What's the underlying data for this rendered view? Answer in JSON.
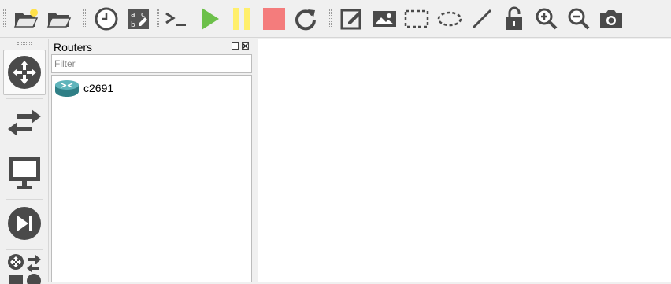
{
  "toolbar": {
    "buttons": [
      {
        "name": "new-project",
        "icon": "folder-new-icon"
      },
      {
        "name": "open-project",
        "icon": "folder-open-icon"
      },
      {
        "name": "snapshot",
        "icon": "clock-icon"
      },
      {
        "name": "show-interface-labels",
        "icon": "abc-labels-icon"
      },
      {
        "name": "console-all",
        "icon": "terminal-icon"
      },
      {
        "name": "start-all",
        "icon": "play-icon"
      },
      {
        "name": "suspend-all",
        "icon": "pause-icon"
      },
      {
        "name": "stop-all",
        "icon": "stop-icon"
      },
      {
        "name": "reload-all",
        "icon": "reload-icon"
      },
      {
        "name": "add-note",
        "icon": "edit-note-icon"
      },
      {
        "name": "insert-image",
        "icon": "picture-icon"
      },
      {
        "name": "draw-rectangle",
        "icon": "rectangle-icon"
      },
      {
        "name": "draw-ellipse",
        "icon": "ellipse-icon"
      },
      {
        "name": "draw-line",
        "icon": "line-icon"
      },
      {
        "name": "lock-items",
        "icon": "unlock-icon"
      },
      {
        "name": "zoom-in",
        "icon": "zoom-in-icon"
      },
      {
        "name": "zoom-out",
        "icon": "zoom-out-icon"
      },
      {
        "name": "screenshot",
        "icon": "camera-icon"
      }
    ]
  },
  "colors": {
    "play": "#6cc04a",
    "pause": "#ffef6b",
    "stop": "#f47c7c",
    "icon_dark": "#4a4a4a"
  },
  "device_bar": {
    "items": [
      "routers-category-icon",
      "switches-category-icon",
      "end-devices-category-icon",
      "security-devices-category-icon",
      "all-devices-category-icon"
    ]
  },
  "panel": {
    "title": "Routers",
    "filter_placeholder": "Filter",
    "filter_value": "",
    "devices": [
      {
        "label": "c2691",
        "icon": "router-icon"
      }
    ]
  }
}
